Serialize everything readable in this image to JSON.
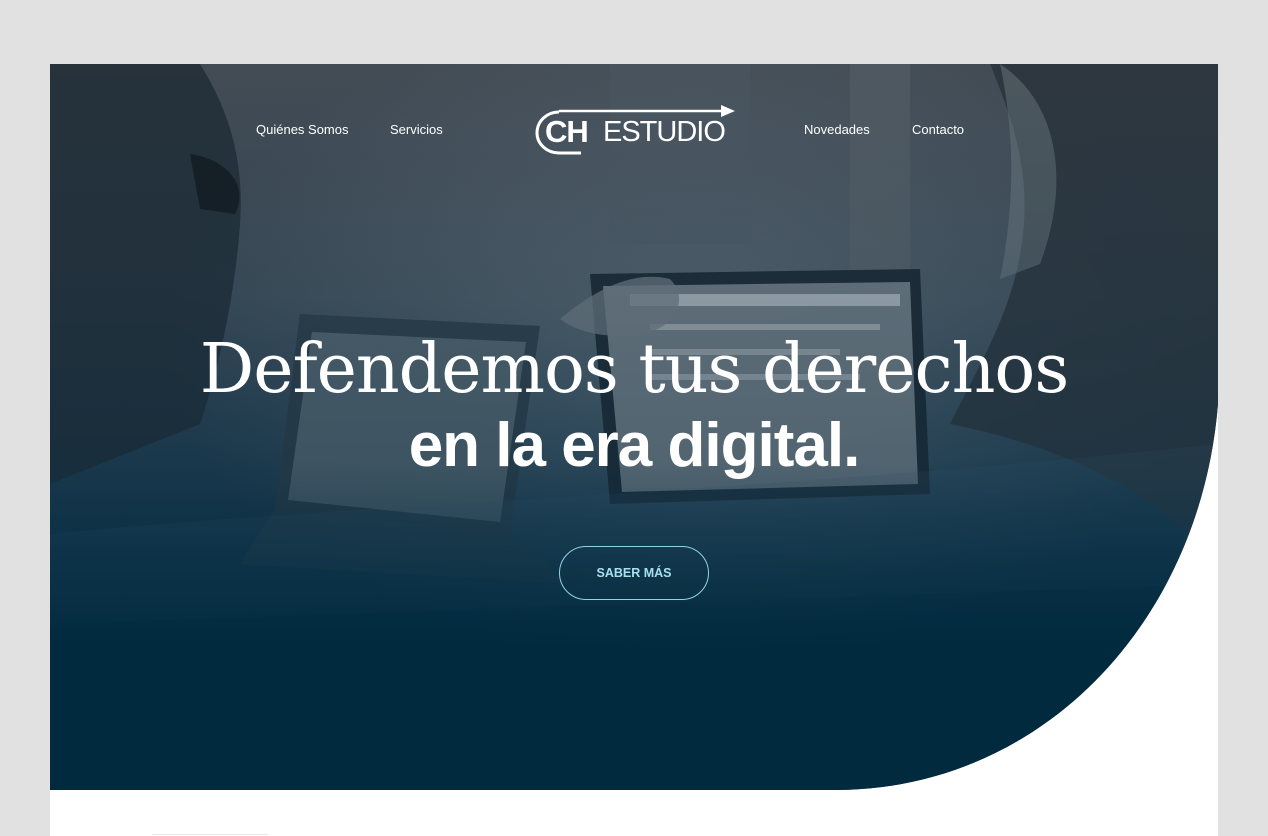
{
  "nav": {
    "left": [
      "Quiénes Somos",
      "Servicios"
    ],
    "right": [
      "Novedades",
      "Contacto"
    ]
  },
  "logo": {
    "ch": "CH",
    "estudio": "ESTUDIO"
  },
  "hero": {
    "headline_line1": "Defendemos tus derechos",
    "headline_line2": "en la era digital.",
    "cta_label": "SABER MÁS"
  },
  "colors": {
    "outer_background": "#e1e1e1",
    "hero_top": "#3a4650",
    "hero_bottom": "#032b40",
    "cta_accent": "#8fd4e0",
    "page": "#ffffff"
  },
  "icons": {
    "logo_arrow": "arrow-right-icon",
    "logo_c": "c-arc-icon"
  }
}
